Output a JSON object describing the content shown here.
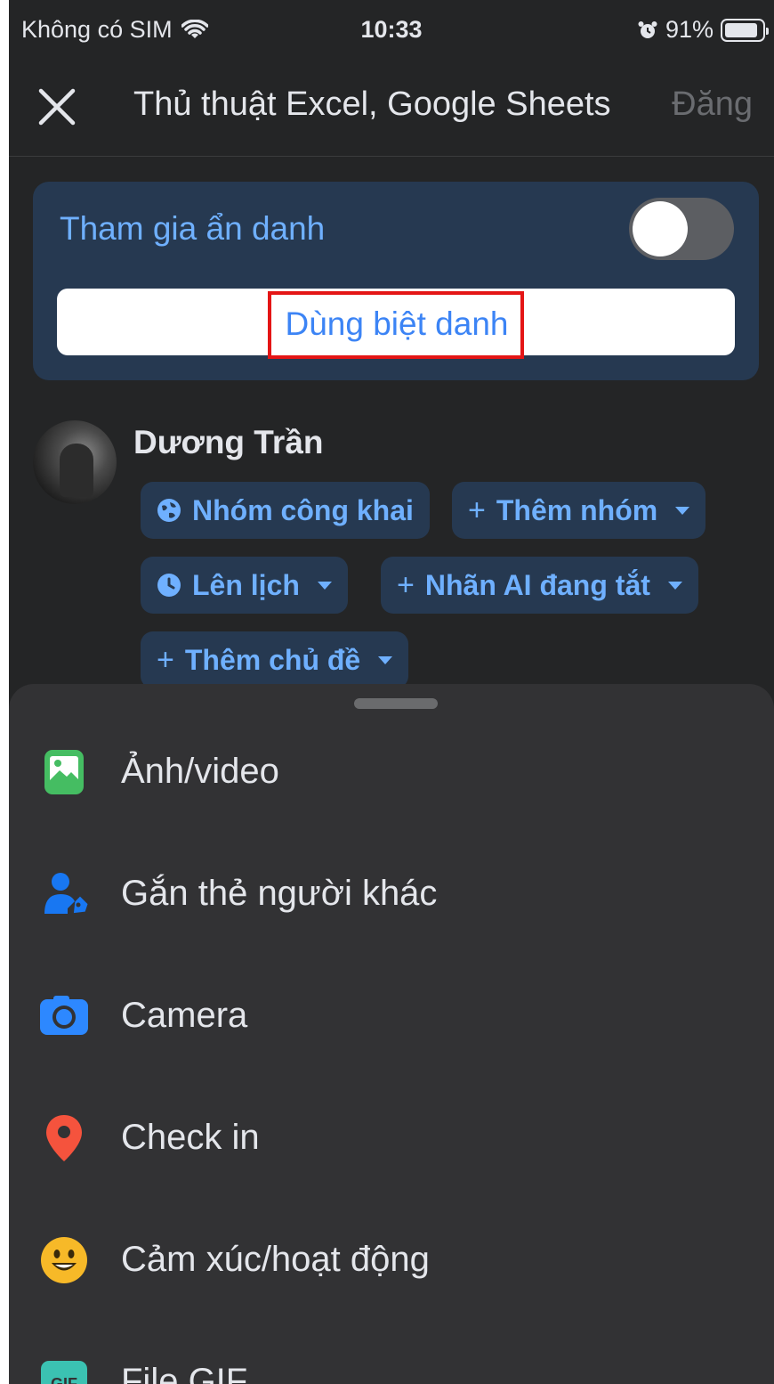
{
  "status_bar": {
    "carrier": "Không có SIM",
    "time": "10:33",
    "battery": "91%",
    "battery_level": 0.91
  },
  "header": {
    "title": "Thủ thuật Excel, Google Sheets",
    "post_label": "Đăng"
  },
  "anonymous": {
    "label": "Tham gia ẩn danh",
    "toggle_on": false,
    "nickname_button": "Dùng biệt danh"
  },
  "author": {
    "name": "Dương Trần"
  },
  "chips": {
    "public_group": "Nhóm công khai",
    "add_group": "Thêm nhóm",
    "schedule": "Lên lịch",
    "ai_label": "Nhãn AI đang tắt",
    "add_topic": "Thêm chủ đề"
  },
  "menu": {
    "items": [
      {
        "label": "Ảnh/video",
        "icon": "photo-icon",
        "color": "#45bd62"
      },
      {
        "label": "Gắn thẻ người khác",
        "icon": "tag-people-icon",
        "color": "#1877f2"
      },
      {
        "label": "Camera",
        "icon": "camera-icon",
        "color": "#2d88ff"
      },
      {
        "label": "Check in",
        "icon": "location-pin-icon",
        "color": "#f5533d"
      },
      {
        "label": "Cảm xúc/hoạt động",
        "icon": "smiley-icon",
        "color": "#f7b928"
      },
      {
        "label": "File GIF",
        "icon": "gif-icon",
        "color": "#3bc2b2"
      }
    ]
  },
  "colors": {
    "accent": "#6fb0ff",
    "highlight_box": "#e41515",
    "card_bg": "#263951"
  }
}
